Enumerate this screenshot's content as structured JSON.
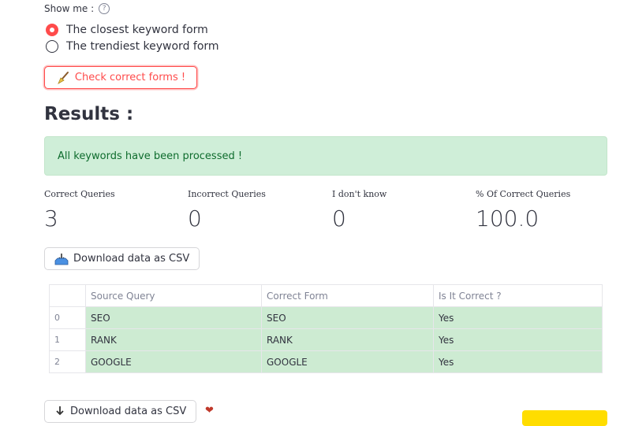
{
  "show_me": {
    "label": "Show me :",
    "help_icon": "question-circle-icon"
  },
  "radios": [
    {
      "label": "The closest keyword form",
      "selected": true
    },
    {
      "label": "The trendiest keyword form",
      "selected": false
    }
  ],
  "check_button": {
    "label": "Check correct forms !",
    "icon": "broom-icon"
  },
  "results": {
    "heading": "Results :"
  },
  "alert": {
    "message": "All keywords have been processed !"
  },
  "metrics": [
    {
      "label": "Correct Queries",
      "value": "3"
    },
    {
      "label": "Incorrect Queries",
      "value": "0"
    },
    {
      "label": "I don't know",
      "value": "0"
    },
    {
      "label": "% Of Correct Queries",
      "value": "100.0"
    }
  ],
  "download_button": {
    "label": "Download data as CSV",
    "icon": "inbox-tray-icon"
  },
  "table": {
    "columns": [
      "",
      "Source Query",
      "Correct Form",
      "Is It Correct ?"
    ],
    "rows": [
      {
        "index": "0",
        "source": "SEO",
        "correct": "SEO",
        "is_correct": "Yes"
      },
      {
        "index": "1",
        "source": "RANK",
        "correct": "RANK",
        "is_correct": "Yes"
      },
      {
        "index": "2",
        "source": "GOOGLE",
        "correct": "GOOGLE",
        "is_correct": "Yes"
      }
    ]
  },
  "download_button_2": {
    "label": "Download data as CSV"
  },
  "colors": {
    "accent": "#ff4b4b",
    "success_bg": "#cfeed8",
    "success_text": "#0e6c2d",
    "table_highlight": "#cdebd2",
    "yellow": "#ffdd00"
  }
}
